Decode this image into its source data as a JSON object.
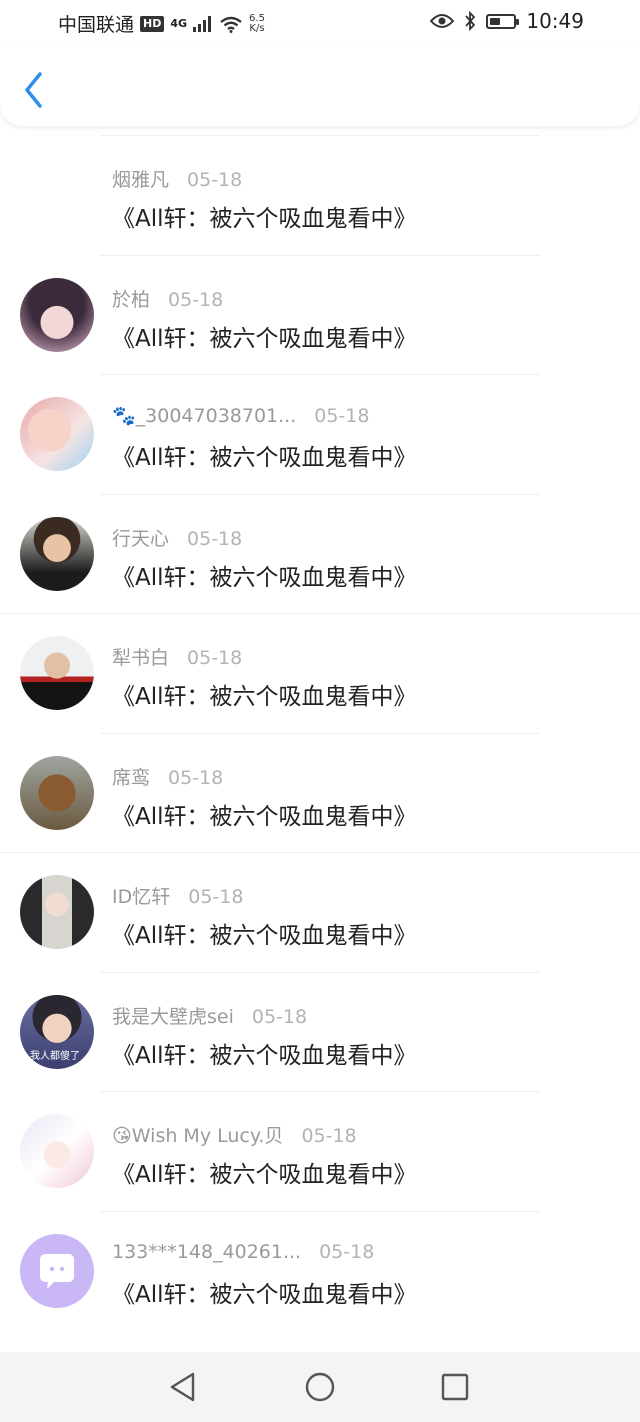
{
  "status_bar": {
    "carrier": "中国联通",
    "hd": "HD",
    "network": "4G",
    "speed_value": "6.5",
    "speed_unit": "K/s",
    "time": "10:49",
    "battery_level": 0.45
  },
  "items": [
    {
      "name": "烟雅凡",
      "date": "05-18",
      "title": "《All轩：被六个吸血鬼看中》",
      "avatar": "none"
    },
    {
      "name": "於柏",
      "date": "05-18",
      "title": "《All轩：被六个吸血鬼看中》",
      "avatar": "anime-girl"
    },
    {
      "name": "🐾_30047038701...",
      "date": "05-18",
      "title": "《All轩：被六个吸血鬼看中》",
      "avatar": "baby-photo"
    },
    {
      "name": "行天心",
      "date": "05-18",
      "title": "《All轩：被六个吸血鬼看中》",
      "avatar": "boy-photo"
    },
    {
      "name": "犁书白",
      "date": "05-18",
      "title": "《All轩：被六个吸血鬼看中》",
      "avatar": "sunglasses-man"
    },
    {
      "name": "席鸾",
      "date": "05-18",
      "title": "《All轩：被六个吸血鬼看中》",
      "avatar": "bear-toy"
    },
    {
      "name": "ID忆轩",
      "date": "05-18",
      "title": "《All轩：被六个吸血鬼看中》",
      "avatar": "costume-actor"
    },
    {
      "name": "我是大壁虎sei",
      "date": "05-18",
      "title": "《All轩：被六个吸血鬼看中》",
      "avatar": "young-man",
      "avatar_caption": "我人都傻了"
    },
    {
      "name": "😘Wish My Lucy.贝",
      "date": "05-18",
      "title": "《All轩：被六个吸血鬼看中》",
      "avatar": "anime-white-hair"
    },
    {
      "name": "133***148_40261...",
      "date": "05-18",
      "title": "《All轩：被六个吸血鬼看中》",
      "avatar": "default-chat-icon"
    }
  ],
  "colors": {
    "accent": "#2f8fe8",
    "name_gray": "#9a9a9a",
    "title_black": "#222222",
    "default_avatar": "#c9b8f5"
  }
}
